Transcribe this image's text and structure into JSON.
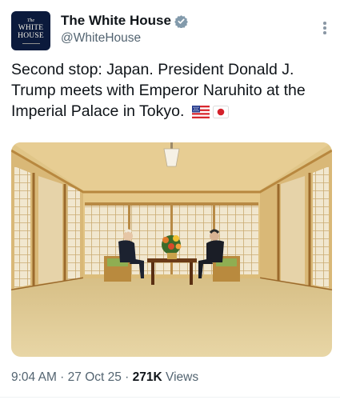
{
  "account": {
    "name": "The White House",
    "handle": "@WhiteHouse",
    "avatar": {
      "the": "The",
      "line1": "WHITE",
      "line2": "HOUSE"
    },
    "verified_icon": "verified-badge-gray"
  },
  "tweet": {
    "text": "Second stop: Japan. President Donald J. Trump meets with Emperor Naruhito at the Imperial Palace in Tokyo.",
    "flags": [
      "us-flag",
      "japan-flag"
    ],
    "photo_icon": "photo"
  },
  "meta": {
    "time": "9:04 AM",
    "sep": " · ",
    "date": "27 Oct 25",
    "views_count": "271K",
    "views_label": " Views"
  },
  "colors": {
    "text": "#0f1419",
    "secondary": "#536471",
    "avatar_bg": "#0b1a3c"
  }
}
